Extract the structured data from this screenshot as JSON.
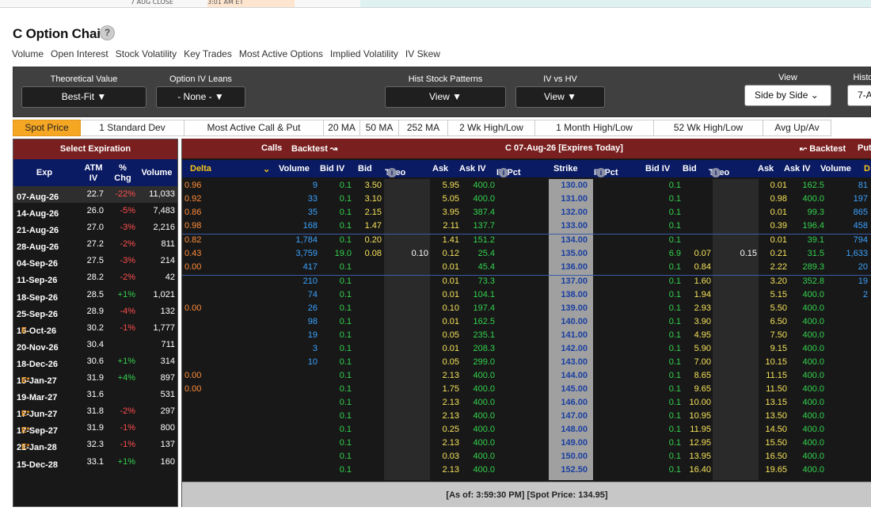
{
  "top_strip": {
    "left_text": "7 AUG CLOSE",
    "mid_text": "3:01 AM ET"
  },
  "page": {
    "title": "C Option Chain",
    "help_icon": "?"
  },
  "nav_links": [
    "Volume",
    "Open Interest",
    "Stock Volatility",
    "Key Trades",
    "Most Active Options",
    "Implied Volatility",
    "IV Skew"
  ],
  "controls": [
    {
      "label": "Theoretical Value",
      "value": "Best-Fit ▼"
    },
    {
      "label": "Option IV Leans",
      "value": "- None - ▼"
    },
    {
      "label": "Hist Stock Patterns",
      "value": "View ▼"
    },
    {
      "label": "IV vs HV",
      "value": "View ▼"
    },
    {
      "label": "View",
      "value": "Side by Side ⌄"
    },
    {
      "label": "Histo",
      "value": "7-Au"
    }
  ],
  "tabs": [
    "Spot Price",
    "1 Standard Dev",
    "Most Active Call & Put",
    "20 MA",
    "50 MA",
    "252 MA",
    "2 Wk High/Low",
    "1 Month High/Low",
    "52 Wk High/Low",
    "Avg Up/Av"
  ],
  "expirations": {
    "title": "Select Expiration",
    "headers": {
      "exp": "Exp",
      "atm_iv_1": "ATM",
      "atm_iv_2": "IV",
      "chg_1": "%",
      "chg_2": "Chg",
      "volume": "Volume"
    },
    "rows": [
      {
        "date": "07-Aug-26",
        "flag": "",
        "iv": "22.7",
        "chg": "-22%",
        "vol": "11,033"
      },
      {
        "date": "14-Aug-26",
        "flag": "",
        "iv": "26.0",
        "chg": "-5%",
        "vol": "7,483"
      },
      {
        "date": "21-Aug-26",
        "flag": "",
        "iv": "27.0",
        "chg": "-3%",
        "vol": "2,216"
      },
      {
        "date": "28-Aug-26",
        "flag": "",
        "iv": "27.2",
        "chg": "-2%",
        "vol": "811"
      },
      {
        "date": "04-Sep-26",
        "flag": "",
        "iv": "27.5",
        "chg": "-3%",
        "vol": "214"
      },
      {
        "date": "11-Sep-26",
        "flag": "",
        "iv": "28.2",
        "chg": "-2%",
        "vol": "42"
      },
      {
        "date": "18-Sep-26",
        "flag": "",
        "iv": "28.5",
        "chg": "+1%",
        "vol": "1,021"
      },
      {
        "date": "25-Sep-26",
        "flag": "",
        "iv": "28.9",
        "chg": "-4%",
        "vol": "132"
      },
      {
        "date": "16-Oct-26",
        "flag": "E",
        "iv": "30.2",
        "chg": "-1%",
        "vol": "1,777"
      },
      {
        "date": "20-Nov-26",
        "flag": "",
        "iv": "30.4",
        "chg": "",
        "vol": "711"
      },
      {
        "date": "18-Dec-26",
        "flag": "",
        "iv": "30.6",
        "chg": "+1%",
        "vol": "314"
      },
      {
        "date": "15-Jan-27",
        "flag": "E*",
        "iv": "31.9",
        "chg": "+4%",
        "vol": "897"
      },
      {
        "date": "19-Mar-27",
        "flag": "",
        "iv": "31.6",
        "chg": "",
        "vol": "531"
      },
      {
        "date": "17-Jun-27",
        "flag": "E*",
        "iv": "31.8",
        "chg": "-2%",
        "vol": "297"
      },
      {
        "date": "17-Sep-27",
        "flag": "E*",
        "iv": "31.9",
        "chg": "-1%",
        "vol": "800"
      },
      {
        "date": "21-Jan-28",
        "flag": "E*",
        "iv": "32.3",
        "chg": "-1%",
        "vol": "137"
      },
      {
        "date": "15-Dec-28",
        "flag": "",
        "iv": "33.1",
        "chg": "+1%",
        "vol": "160"
      }
    ]
  },
  "chain": {
    "header": {
      "calls": "Calls",
      "backtest_left": "Backtest ↝",
      "title": "C 07-Aug-26 [Expires Today]",
      "backtest_right": "↜ Backtest",
      "puts": "Put"
    },
    "columns": {
      "delta": "Delta",
      "delta_caret": "⌄",
      "volume": "Volume",
      "bid_iv": "Bid IV",
      "bid": "Bid",
      "theo": "Theo",
      "ask": "Ask",
      "ask_iv": "Ask IV",
      "iv_pct": "IV Pct",
      "strike": "Strike",
      "p_iv_pct": "IV Pct",
      "p_bid_iv": "Bid IV",
      "p_bid": "Bid",
      "p_theo": "Theo",
      "p_ask": "Ask",
      "p_ask_iv": "Ask IV",
      "p_volume": "Volume",
      "p_delta": "D",
      "info": "i"
    },
    "rows": [
      {
        "delta": "0.96",
        "vol": "9",
        "biv": "0.1",
        "bid": "3.50",
        "theo": "",
        "ask": "5.95",
        "aiv": "400.0",
        "strike": "130.00",
        "pbiv": "0.1",
        "pbid": "",
        "ptheo": "",
        "pask": "0.01",
        "paiv": "162.5",
        "pvol": "81"
      },
      {
        "delta": "0.92",
        "vol": "33",
        "biv": "0.1",
        "bid": "3.10",
        "theo": "",
        "ask": "5.05",
        "aiv": "400.0",
        "strike": "131.00",
        "pbiv": "0.1",
        "pbid": "",
        "ptheo": "",
        "pask": "0.98",
        "paiv": "400.0",
        "pvol": "197"
      },
      {
        "delta": "0.86",
        "vol": "35",
        "biv": "0.1",
        "bid": "2.15",
        "theo": "",
        "ask": "3.95",
        "aiv": "387.4",
        "strike": "132.00",
        "pbiv": "0.1",
        "pbid": "",
        "ptheo": "",
        "pask": "0.01",
        "paiv": "99.3",
        "pvol": "865"
      },
      {
        "delta": "0.98",
        "vol": "168",
        "biv": "0.1",
        "bid": "1.47",
        "theo": "",
        "ask": "2.11",
        "aiv": "137.7",
        "strike": "133.00",
        "pbiv": "0.1",
        "pbid": "",
        "ptheo": "",
        "pask": "0.39",
        "paiv": "196.4",
        "pvol": "458"
      },
      {
        "delta": "0.82",
        "vol": "1,784",
        "biv": "0.1",
        "bid": "0.20",
        "theo": "",
        "ask": "1.41",
        "aiv": "151.2",
        "strike": "134.00",
        "pbiv": "0.1",
        "pbid": "",
        "ptheo": "",
        "pask": "0.01",
        "paiv": "39.1",
        "pvol": "794"
      },
      {
        "delta": "0.43",
        "vol": "3,759",
        "biv": "19.0",
        "bid": "0.08",
        "theo": "0.10",
        "ask": "0.12",
        "aiv": "25.4",
        "strike": "135.00",
        "pbiv": "6.9",
        "pbid": "0.07",
        "ptheo": "0.15",
        "pask": "0.21",
        "paiv": "31.5",
        "pvol": "1,633"
      },
      {
        "delta": "0.00",
        "vol": "417",
        "biv": "0.1",
        "bid": "",
        "theo": "",
        "ask": "0.01",
        "aiv": "45.4",
        "strike": "136.00",
        "pbiv": "0.1",
        "pbid": "0.84",
        "ptheo": "",
        "pask": "2.22",
        "paiv": "289.3",
        "pvol": "20"
      },
      {
        "delta": "",
        "vol": "210",
        "biv": "0.1",
        "bid": "",
        "theo": "",
        "ask": "0.01",
        "aiv": "73.3",
        "strike": "137.00",
        "pbiv": "0.1",
        "pbid": "1.60",
        "ptheo": "",
        "pask": "3.20",
        "paiv": "352.8",
        "pvol": "19"
      },
      {
        "delta": "",
        "vol": "74",
        "biv": "0.1",
        "bid": "",
        "theo": "",
        "ask": "0.01",
        "aiv": "104.1",
        "strike": "138.00",
        "pbiv": "0.1",
        "pbid": "1.94",
        "ptheo": "",
        "pask": "5.15",
        "paiv": "400.0",
        "pvol": "2"
      },
      {
        "delta": "0.00",
        "vol": "26",
        "biv": "0.1",
        "bid": "",
        "theo": "",
        "ask": "0.10",
        "aiv": "197.4",
        "strike": "139.00",
        "pbiv": "0.1",
        "pbid": "2.93",
        "ptheo": "",
        "pask": "5.50",
        "paiv": "400.0",
        "pvol": ""
      },
      {
        "delta": "",
        "vol": "98",
        "biv": "0.1",
        "bid": "",
        "theo": "",
        "ask": "0.01",
        "aiv": "162.5",
        "strike": "140.00",
        "pbiv": "0.1",
        "pbid": "3.90",
        "ptheo": "",
        "pask": "6.50",
        "paiv": "400.0",
        "pvol": ""
      },
      {
        "delta": "",
        "vol": "19",
        "biv": "0.1",
        "bid": "",
        "theo": "",
        "ask": "0.05",
        "aiv": "235.1",
        "strike": "141.00",
        "pbiv": "0.1",
        "pbid": "4.95",
        "ptheo": "",
        "pask": "7.50",
        "paiv": "400.0",
        "pvol": ""
      },
      {
        "delta": "",
        "vol": "3",
        "biv": "0.1",
        "bid": "",
        "theo": "",
        "ask": "0.01",
        "aiv": "208.3",
        "strike": "142.00",
        "pbiv": "0.1",
        "pbid": "5.90",
        "ptheo": "",
        "pask": "9.15",
        "paiv": "400.0",
        "pvol": ""
      },
      {
        "delta": "",
        "vol": "10",
        "biv": "0.1",
        "bid": "",
        "theo": "",
        "ask": "0.05",
        "aiv": "299.0",
        "strike": "143.00",
        "pbiv": "0.1",
        "pbid": "7.00",
        "ptheo": "",
        "pask": "10.15",
        "paiv": "400.0",
        "pvol": ""
      },
      {
        "delta": "0.00",
        "vol": "",
        "biv": "0.1",
        "bid": "",
        "theo": "",
        "ask": "2.13",
        "aiv": "400.0",
        "strike": "144.00",
        "pbiv": "0.1",
        "pbid": "8.65",
        "ptheo": "",
        "pask": "11.15",
        "paiv": "400.0",
        "pvol": ""
      },
      {
        "delta": "0.00",
        "vol": "",
        "biv": "0.1",
        "bid": "",
        "theo": "",
        "ask": "1.75",
        "aiv": "400.0",
        "strike": "145.00",
        "pbiv": "0.1",
        "pbid": "9.65",
        "ptheo": "",
        "pask": "11.50",
        "paiv": "400.0",
        "pvol": ""
      },
      {
        "delta": "",
        "vol": "",
        "biv": "0.1",
        "bid": "",
        "theo": "",
        "ask": "2.13",
        "aiv": "400.0",
        "strike": "146.00",
        "pbiv": "0.1",
        "pbid": "10.00",
        "ptheo": "",
        "pask": "13.15",
        "paiv": "400.0",
        "pvol": ""
      },
      {
        "delta": "",
        "vol": "",
        "biv": "0.1",
        "bid": "",
        "theo": "",
        "ask": "2.13",
        "aiv": "400.0",
        "strike": "147.00",
        "pbiv": "0.1",
        "pbid": "10.95",
        "ptheo": "",
        "pask": "13.50",
        "paiv": "400.0",
        "pvol": ""
      },
      {
        "delta": "",
        "vol": "",
        "biv": "0.1",
        "bid": "",
        "theo": "",
        "ask": "0.25",
        "aiv": "400.0",
        "strike": "148.00",
        "pbiv": "0.1",
        "pbid": "11.95",
        "ptheo": "",
        "pask": "14.50",
        "paiv": "400.0",
        "pvol": ""
      },
      {
        "delta": "",
        "vol": "",
        "biv": "0.1",
        "bid": "",
        "theo": "",
        "ask": "2.13",
        "aiv": "400.0",
        "strike": "149.00",
        "pbiv": "0.1",
        "pbid": "12.95",
        "ptheo": "",
        "pask": "15.50",
        "paiv": "400.0",
        "pvol": ""
      },
      {
        "delta": "",
        "vol": "",
        "biv": "0.1",
        "bid": "",
        "theo": "",
        "ask": "0.03",
        "aiv": "400.0",
        "strike": "150.00",
        "pbiv": "0.1",
        "pbid": "13.95",
        "ptheo": "",
        "pask": "16.50",
        "paiv": "400.0",
        "pvol": ""
      },
      {
        "delta": "",
        "vol": "",
        "biv": "0.1",
        "bid": "",
        "theo": "",
        "ask": "2.13",
        "aiv": "400.0",
        "strike": "152.50",
        "pbiv": "0.1",
        "pbid": "16.40",
        "ptheo": "",
        "pask": "19.65",
        "paiv": "400.0",
        "pvol": ""
      }
    ],
    "footer": "[As of: 3:59:30 PM] [Spot Price: 134.95]"
  }
}
